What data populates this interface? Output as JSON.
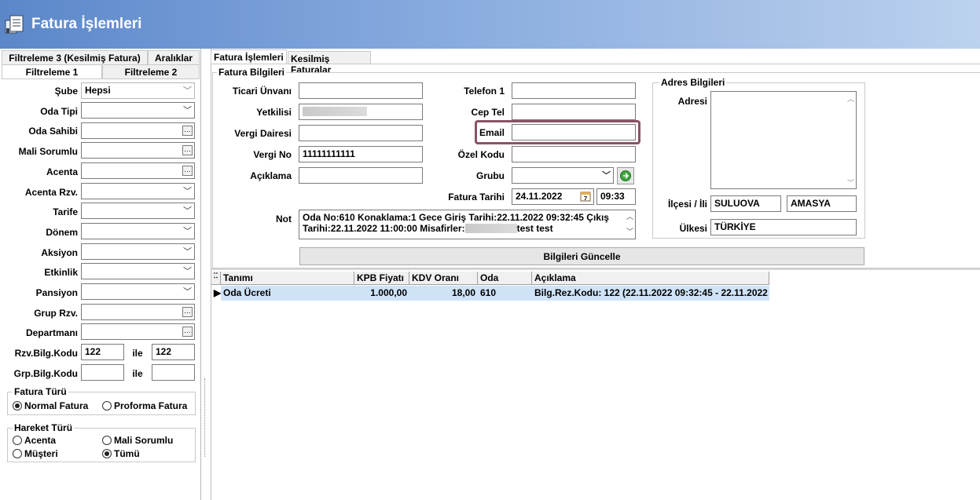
{
  "window": {
    "title": "Fatura İşlemleri"
  },
  "left": {
    "tabs_top": [
      "Filtreleme 3 (Kesilmiş Fatura)",
      "Aralıklar"
    ],
    "tabs_bottom": [
      "Filtreleme 1",
      "Filtreleme 2"
    ],
    "fields": [
      {
        "label": "Şube",
        "value": "Hepsi"
      },
      {
        "label": "Oda Tipi",
        "value": ""
      },
      {
        "label": "Oda Sahibi",
        "value": ""
      },
      {
        "label": "Mali Sorumlu",
        "value": ""
      },
      {
        "label": "Acenta",
        "value": ""
      },
      {
        "label": "Acenta Rzv.",
        "value": ""
      },
      {
        "label": "Tarife",
        "value": ""
      },
      {
        "label": "Dönem",
        "value": ""
      },
      {
        "label": "Aksiyon",
        "value": ""
      },
      {
        "label": "Etkinlik",
        "value": ""
      },
      {
        "label": "Pansiyon",
        "value": ""
      },
      {
        "label": "Grup Rzv.",
        "value": ""
      },
      {
        "label": "Departmanı",
        "value": ""
      }
    ],
    "rzv_bilg_kodu": {
      "label": "Rzv.Bilg.Kodu",
      "from": "122",
      "sep": "ile",
      "to": "122"
    },
    "grp_bilg_kodu": {
      "label": "Grp.Bilg.Kodu",
      "from": "",
      "sep": "ile",
      "to": ""
    },
    "fatura_turu": {
      "title": "Fatura Türü",
      "options": [
        "Normal Fatura",
        "Proforma Fatura"
      ],
      "selected": "Normal Fatura"
    },
    "hareket_turu": {
      "title": "Hareket Türü",
      "options": [
        "Acenta",
        "Mali Sorumlu",
        "Müşteri",
        "Tümü"
      ],
      "selected": "Tümü"
    }
  },
  "right": {
    "tabs": [
      "Fatura İşlemleri",
      "Kesilmiş Faturalar"
    ],
    "group_title": "Fatura Bilgileri",
    "ticari_unvani": {
      "label": "Ticari Ünvanı",
      "value": ""
    },
    "yetkilisi": {
      "label": "Yetkilisi",
      "value": ""
    },
    "vergi_dairesi": {
      "label": "Vergi Dairesi",
      "value": ""
    },
    "vergi_no": {
      "label": "Vergi No",
      "value": "11111111111"
    },
    "aciklama": {
      "label": "Açıklama",
      "value": ""
    },
    "telefon1": {
      "label": "Telefon 1",
      "value": ""
    },
    "cep_tel": {
      "label": "Cep Tel",
      "value": ""
    },
    "email": {
      "label": "Email",
      "value": ""
    },
    "ozel_kodu": {
      "label": "Özel Kodu",
      "value": ""
    },
    "grubu": {
      "label": "Grubu",
      "value": ""
    },
    "fatura_tarihi": {
      "label": "Fatura Tarihi",
      "date": "24.11.2022",
      "time": "09:33"
    },
    "not": {
      "label": "Not",
      "line1": "Oda No:610 Konaklama:1 Gece Giriş Tarihi:22.11.2022 09:32:45 Çıkış",
      "line2_a": "Tarihi:22.11.2022 11:00:00 Misafirler:",
      "line2_b": "test test"
    },
    "adres": {
      "title": "Adres Bilgileri",
      "adresi_label": "Adresi",
      "ilce_il_label": "İlçesi / İli",
      "ilce": "SULUOVA",
      "il": "AMASYA",
      "ulkesi_label": "Ülkesi",
      "ulke": "TÜRKİYE"
    },
    "update_button": "Bilgileri Güncelle"
  },
  "grid": {
    "columns": [
      "Tanımı",
      "KPB Fiyatı",
      "KDV Oranı",
      "Oda",
      "Açıklama"
    ],
    "rows": [
      {
        "tanimi": "Oda Ücreti",
        "kpb_fiyati": "1.000,00",
        "kdv_orani": "18,00",
        "oda": "610",
        "aciklama": "Bilg.Rez.Kodu: 122 (22.11.2022 09:32:45 - 22.11.2022"
      }
    ]
  }
}
